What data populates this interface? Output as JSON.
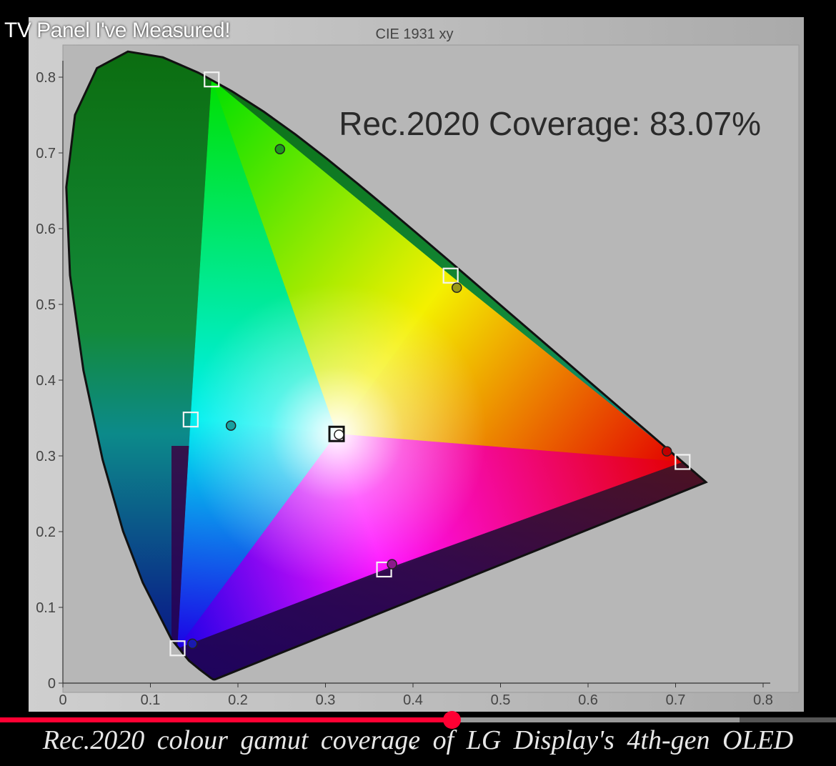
{
  "video": {
    "title": "TV Panel I've Measured!",
    "caption": "Rec.2020 colour gamut coverage of LG Display's 4th-gen OLED",
    "progress": 0.54,
    "buffered": 0.885
  },
  "chart_data": {
    "type": "scatter",
    "title": "CIE 1931 xy",
    "annotation": "Rec.2020 Coverage: 83.07%",
    "xlim": [
      0,
      0.8
    ],
    "ylim": [
      0,
      0.8
    ],
    "xticks": [
      "0",
      "0.1",
      "0.2",
      "0.3",
      "0.4",
      "0.5",
      "0.6",
      "0.7",
      "0.8"
    ],
    "yticks": [
      "0",
      "0.1",
      "0.2",
      "0.3",
      "0.4",
      "0.5",
      "0.6",
      "0.7",
      "0.8"
    ],
    "grid": false,
    "colors": {
      "red": "#e30000",
      "green": "#00e000",
      "blue": "#1c00e6",
      "cyan": "#00f0f0",
      "magenta": "#ff10ff",
      "yellow": "#f4f000",
      "white": "#ffffff"
    },
    "series": [
      {
        "marker": "square",
        "points": [
          {
            "x": 0.708,
            "y": 0.292
          },
          {
            "x": 0.17,
            "y": 0.797
          },
          {
            "x": 0.131,
            "y": 0.046
          },
          {
            "x": 0.443,
            "y": 0.538
          },
          {
            "x": 0.146,
            "y": 0.348
          },
          {
            "x": 0.367,
            "y": 0.15
          },
          {
            "x": 0.3127,
            "y": 0.329
          }
        ]
      },
      {
        "marker": "circle",
        "points": [
          {
            "x": 0.69,
            "y": 0.306,
            "color": "#c00000"
          },
          {
            "x": 0.248,
            "y": 0.705,
            "color": "#1c9a1c"
          },
          {
            "x": 0.148,
            "y": 0.052,
            "color": "#1a1ab0"
          },
          {
            "x": 0.45,
            "y": 0.522,
            "color": "#9a9a18"
          },
          {
            "x": 0.192,
            "y": 0.34,
            "color": "#17a0a0"
          },
          {
            "x": 0.376,
            "y": 0.157,
            "color": "#8b1a8b"
          },
          {
            "x": 0.3155,
            "y": 0.328,
            "color": "#ffffff"
          }
        ]
      }
    ],
    "spectral_locus": [
      [
        0.1741,
        0.005
      ],
      [
        0.1738,
        0.0049
      ],
      [
        0.1736,
        0.0049
      ],
      [
        0.1733,
        0.0048
      ],
      [
        0.1726,
        0.0048
      ],
      [
        0.1714,
        0.0051
      ],
      [
        0.1689,
        0.0069
      ],
      [
        0.1644,
        0.0109
      ],
      [
        0.1566,
        0.0177
      ],
      [
        0.144,
        0.0297
      ],
      [
        0.1241,
        0.0578
      ],
      [
        0.0913,
        0.1327
      ],
      [
        0.0687,
        0.2007
      ],
      [
        0.0454,
        0.295
      ],
      [
        0.0235,
        0.4127
      ],
      [
        0.0082,
        0.5384
      ],
      [
        0.0039,
        0.6548
      ],
      [
        0.0139,
        0.7502
      ],
      [
        0.0389,
        0.812
      ],
      [
        0.0743,
        0.8338
      ],
      [
        0.1142,
        0.8262
      ],
      [
        0.1547,
        0.8059
      ],
      [
        0.1929,
        0.7816
      ],
      [
        0.2296,
        0.7543
      ],
      [
        0.2658,
        0.7243
      ],
      [
        0.3016,
        0.6923
      ],
      [
        0.3373,
        0.6589
      ],
      [
        0.3731,
        0.6245
      ],
      [
        0.4087,
        0.5896
      ],
      [
        0.4441,
        0.5547
      ],
      [
        0.4788,
        0.5202
      ],
      [
        0.5125,
        0.4866
      ],
      [
        0.5448,
        0.4544
      ],
      [
        0.5752,
        0.4242
      ],
      [
        0.6029,
        0.3965
      ],
      [
        0.627,
        0.3725
      ],
      [
        0.6482,
        0.3514
      ],
      [
        0.6658,
        0.334
      ],
      [
        0.6801,
        0.3197
      ],
      [
        0.6915,
        0.3083
      ],
      [
        0.7006,
        0.2993
      ],
      [
        0.7079,
        0.292
      ],
      [
        0.714,
        0.2859
      ],
      [
        0.719,
        0.2809
      ],
      [
        0.723,
        0.277
      ],
      [
        0.726,
        0.274
      ],
      [
        0.7283,
        0.2717
      ],
      [
        0.73,
        0.27
      ],
      [
        0.7347,
        0.2653
      ]
    ]
  }
}
